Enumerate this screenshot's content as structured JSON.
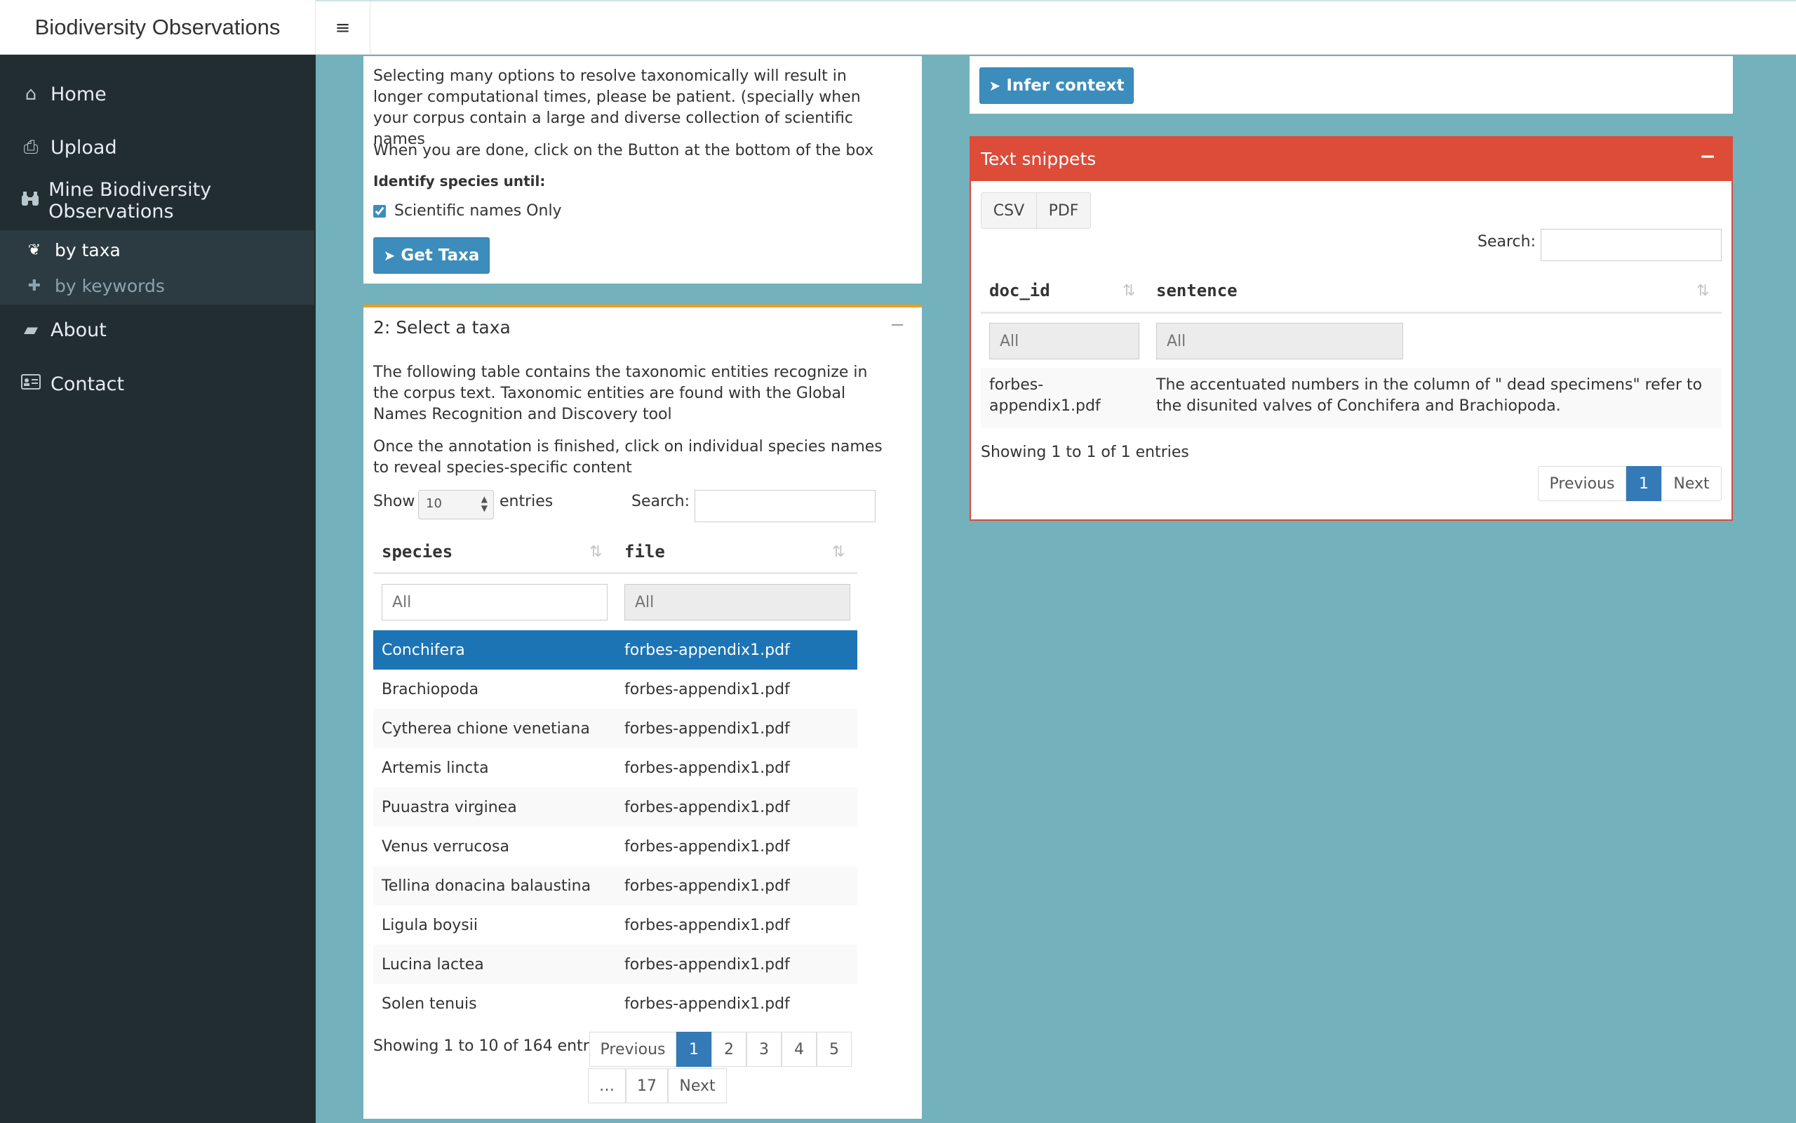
{
  "app": {
    "title": "Biodiversity Observations",
    "menu_toggle": "≡"
  },
  "sidebar": {
    "items": [
      {
        "label": "Home",
        "icon": "home-icon"
      },
      {
        "label": "Upload",
        "icon": "upload-icon"
      },
      {
        "label": "Mine Biodiversity Observations",
        "icon": "binoculars-icon"
      },
      {
        "label": "About",
        "icon": "folder-icon"
      },
      {
        "label": "Contact",
        "icon": "address-card-icon"
      }
    ],
    "subitems": [
      {
        "label": "by taxa",
        "icon": "leaf-icon"
      },
      {
        "label": "by keywords",
        "icon": "puzzle-icon"
      }
    ]
  },
  "box1": {
    "para1": "Selecting many options to resolve taxonomically will result in longer computational times, please be patient. (specially when your corpus contain a large and diverse collection of scientific names",
    "para2": "When you are done, click on the Button at the bottom of the box",
    "identify_label": "Identify species until:",
    "checkbox_label": "Scientific names Only",
    "checkbox_checked": true,
    "button": "Get Taxa"
  },
  "box2": {
    "title": "2: Select a taxa",
    "collapse": "−",
    "para1": "The following table contains the taxonomic entities recognize in the corpus text. Taxonomic entities are found with the Global Names Recognition and Discovery tool",
    "para2": "Once the annotation is finished, click on individual species names to reveal species-specific content",
    "show_label": "Show",
    "show_value": "10",
    "entries_label": "entries",
    "search_label": "Search:",
    "headers": [
      "species",
      "file"
    ],
    "filter_placeholders": [
      "All",
      "All"
    ],
    "rows": [
      {
        "species": "Conchifera",
        "file": "forbes-appendix1.pdf"
      },
      {
        "species": "Brachiopoda",
        "file": "forbes-appendix1.pdf"
      },
      {
        "species": "Cytherea chione venetiana",
        "file": "forbes-appendix1.pdf"
      },
      {
        "species": "Artemis lincta",
        "file": "forbes-appendix1.pdf"
      },
      {
        "species": "Puuastra virginea",
        "file": "forbes-appendix1.pdf"
      },
      {
        "species": "Venus verrucosa",
        "file": "forbes-appendix1.pdf"
      },
      {
        "species": "Tellina donacina balaustina",
        "file": "forbes-appendix1.pdf"
      },
      {
        "species": "Ligula boysii",
        "file": "forbes-appendix1.pdf"
      },
      {
        "species": "Lucina lactea",
        "file": "forbes-appendix1.pdf"
      },
      {
        "species": "Solen tenuis",
        "file": "forbes-appendix1.pdf"
      }
    ],
    "info": "Showing 1 to 10 of 164 entries",
    "pagination": [
      "Previous",
      "1",
      "2",
      "3",
      "4",
      "5",
      "…",
      "17",
      "Next"
    ]
  },
  "box3": {
    "button": "Infer context"
  },
  "box4": {
    "title": "Text snippets",
    "collapse": "−",
    "export_buttons": [
      "CSV",
      "PDF"
    ],
    "search_label": "Search:",
    "headers": [
      "doc_id",
      "sentence"
    ],
    "filter_placeholders": [
      "All",
      "All"
    ],
    "rows": [
      {
        "doc_id": "forbes-appendix1.pdf",
        "doc_id_line1": "forbes-",
        "doc_id_line2": "appendix1.pdf",
        "sentence": "The accentuated numbers in the column of \" dead specimens\" refer to the disunited valves of Conchifera and Brachiopoda."
      }
    ],
    "info": "Showing 1 to 1 of 1 entries",
    "pagination": [
      "Previous",
      "1",
      "Next"
    ]
  },
  "colors": {
    "background": "#73b1bd",
    "sidebar": "#222d32",
    "primary": "#3c8dbc",
    "selected_row": "#1c74b5",
    "danger_header": "#dd4b39",
    "warning_top": "#f39c12"
  }
}
